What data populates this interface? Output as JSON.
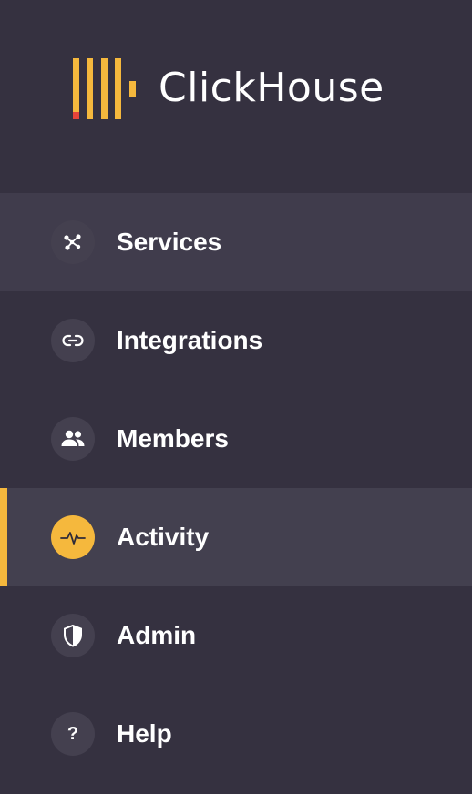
{
  "brand": {
    "name": "ClickHouse",
    "colors": {
      "accent": "#f5b83d",
      "accent_tip": "#e5443a",
      "background": "#353140",
      "active_background": "#43404f",
      "icon_circle": "#44404f",
      "text": "#ffffff"
    }
  },
  "nav": {
    "items": [
      {
        "label": "Services",
        "icon": "services-nodes-icon",
        "state": "hover"
      },
      {
        "label": "Integrations",
        "icon": "link-icon",
        "state": "normal"
      },
      {
        "label": "Members",
        "icon": "people-icon",
        "state": "normal"
      },
      {
        "label": "Activity",
        "icon": "pulse-icon",
        "state": "active"
      },
      {
        "label": "Admin",
        "icon": "shield-icon",
        "state": "normal"
      },
      {
        "label": "Help",
        "icon": "help-icon",
        "icon_glyph": "?",
        "state": "normal"
      }
    ]
  }
}
